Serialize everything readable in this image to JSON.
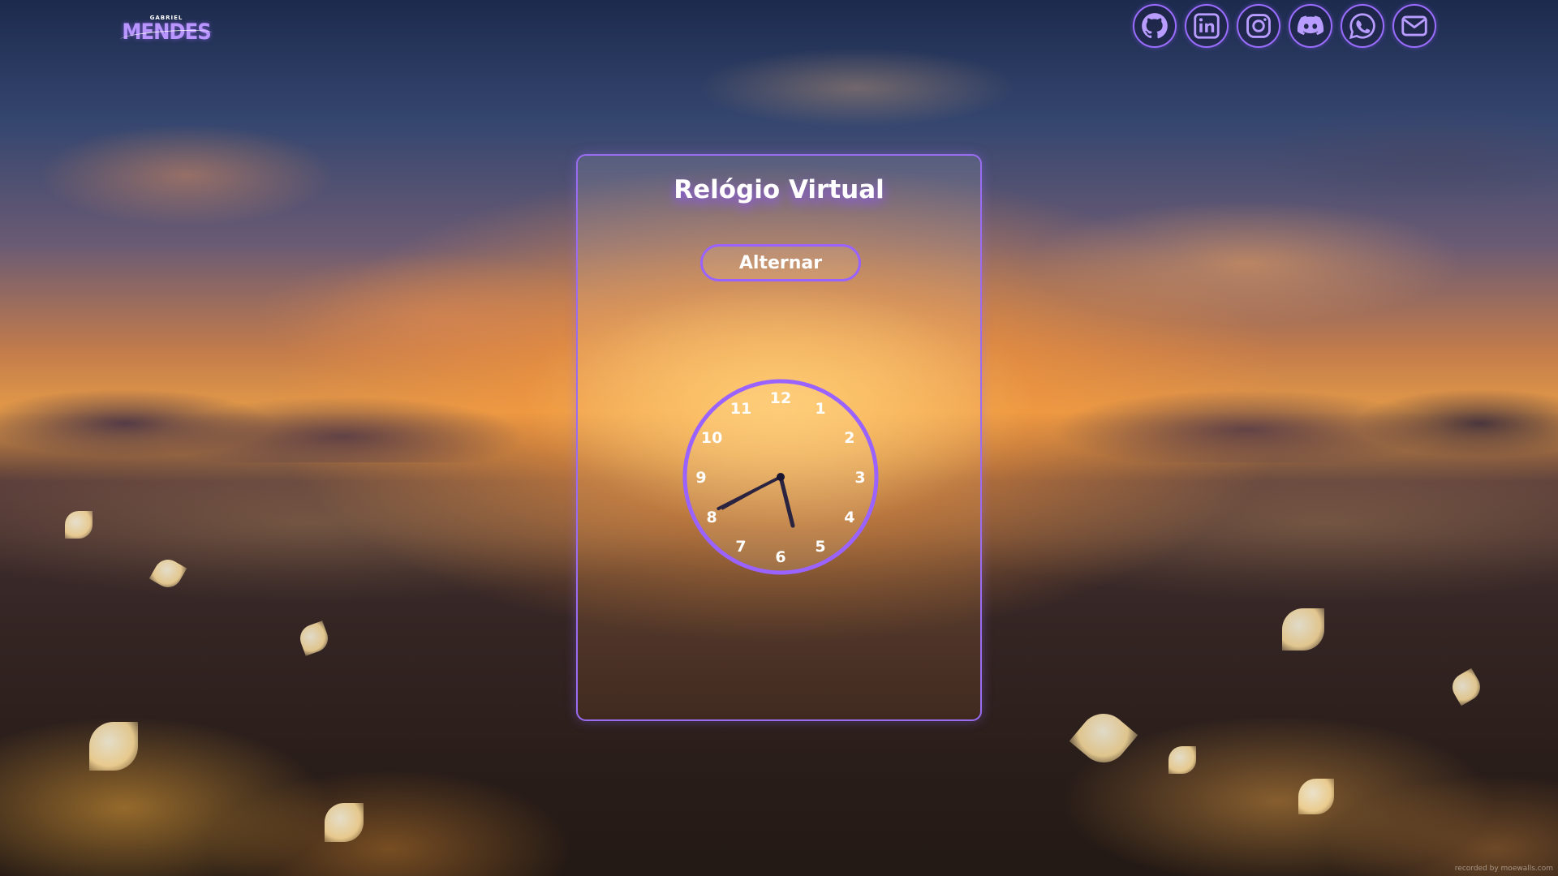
{
  "header": {
    "logo_top": "GABRIEL",
    "logo_main": "MENDES",
    "socials": [
      {
        "name": "github",
        "icon": "github-icon"
      },
      {
        "name": "linkedin",
        "icon": "linkedin-icon"
      },
      {
        "name": "instagram",
        "icon": "instagram-icon"
      },
      {
        "name": "discord",
        "icon": "discord-icon"
      },
      {
        "name": "whatsapp",
        "icon": "whatsapp-icon"
      },
      {
        "name": "email",
        "icon": "envelope-icon"
      }
    ]
  },
  "card": {
    "title": "Relógio Virtual",
    "toggle_label": "Alternar"
  },
  "clock": {
    "numbers": [
      "12",
      "1",
      "2",
      "3",
      "4",
      "5",
      "6",
      "7",
      "8",
      "9",
      "10",
      "11"
    ],
    "hour_hand_angle_deg": 166,
    "minute_hand_angle_deg": 243,
    "second_hand_angle_deg": 241
  },
  "colors": {
    "accent": "#9a63ff",
    "hand_dark": "#2a2440",
    "text": "#ffffff"
  },
  "footer": {
    "watermark": "recorded by moewalls.com"
  }
}
